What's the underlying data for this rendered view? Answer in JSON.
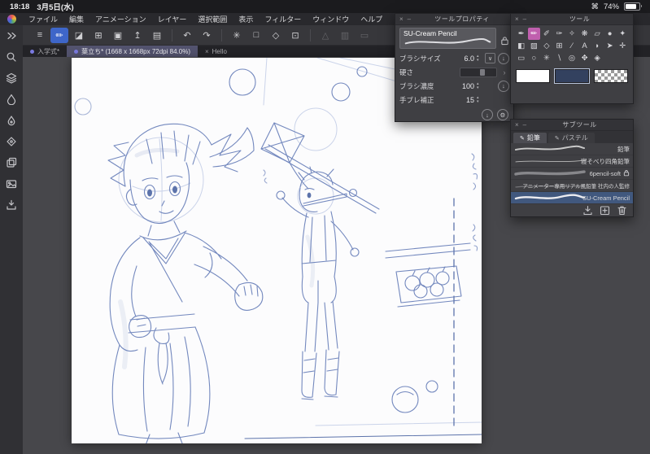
{
  "status_bar": {
    "time": "18:18",
    "date": "3月5日(水)",
    "command_icon": "⌘",
    "battery_percent": "74%"
  },
  "menu_bar": {
    "items": [
      "ファイル",
      "編集",
      "アニメーション",
      "レイヤー",
      "選択範囲",
      "表示",
      "フィルター",
      "ウィンドウ",
      "ヘルプ"
    ]
  },
  "toolbar": {
    "buttons": [
      {
        "name": "main-menu",
        "glyph": "≡"
      },
      {
        "name": "brush-tool",
        "glyph": "✏"
      },
      {
        "name": "color-set",
        "glyph": "◪"
      },
      {
        "name": "new-canvas",
        "glyph": "⊞"
      },
      {
        "name": "open-file",
        "glyph": "▣"
      },
      {
        "name": "export",
        "glyph": "↥"
      },
      {
        "name": "print",
        "glyph": "▤"
      },
      {
        "name": "undo",
        "glyph": "↶"
      },
      {
        "name": "redo",
        "glyph": "↷"
      },
      {
        "name": "auto-select",
        "glyph": "✳"
      },
      {
        "name": "select-area",
        "glyph": "□"
      },
      {
        "name": "eraser",
        "glyph": "◇"
      },
      {
        "name": "crop",
        "glyph": "⊡"
      },
      {
        "name": "snap-linear",
        "glyph": "△"
      },
      {
        "name": "snap-curve",
        "glyph": "▥"
      },
      {
        "name": "snap-ruler",
        "glyph": "▭"
      }
    ]
  },
  "tab_bar": {
    "tabs": [
      {
        "label": "入学式*"
      },
      {
        "label": "葉立ち* (1668 x 1668px 72dpi 84.0%)"
      },
      {
        "label": "Hello",
        "close": "×"
      }
    ]
  },
  "sidebar": {
    "items": [
      "collapse",
      "search",
      "layer-stack",
      "ink-droplet",
      "paint-droplet",
      "material",
      "layers-alt",
      "image",
      "import"
    ]
  },
  "tool_property_panel": {
    "close": "×",
    "minimize": "–",
    "title": "ツールプロパティ",
    "brush_name": "SU-Cream Pencil",
    "params": [
      {
        "label": "ブラシサイズ",
        "value": "6.0"
      },
      {
        "label": "硬さ",
        "value": ""
      },
      {
        "label": "ブラシ濃度",
        "value": "100"
      },
      {
        "label": "手ブレ補正",
        "value": "15"
      }
    ],
    "stepper_up": "▴",
    "stepper_down": "▾",
    "dropdown": "∨",
    "chevron": "›",
    "slider_button": "↓",
    "save_default": "↓",
    "settings": "⚙"
  },
  "tool_panel": {
    "close": "×",
    "minimize": "–",
    "title": "ツール",
    "tools": [
      {
        "name": "pen",
        "glyph": "✒"
      },
      {
        "name": "pencil",
        "glyph": "✏",
        "selected": true
      },
      {
        "name": "marker",
        "glyph": "✐"
      },
      {
        "name": "brush",
        "glyph": "✑"
      },
      {
        "name": "airbrush",
        "glyph": "✧"
      },
      {
        "name": "decoration",
        "glyph": "❋"
      },
      {
        "name": "eraser",
        "glyph": "▱"
      },
      {
        "name": "blend",
        "glyph": "●"
      },
      {
        "name": "liquify",
        "glyph": "✦"
      },
      {
        "name": "fill",
        "glyph": "◧"
      },
      {
        "name": "gradient",
        "glyph": "▨"
      },
      {
        "name": "figure",
        "glyph": "◇"
      },
      {
        "name": "frame",
        "glyph": "⊞"
      },
      {
        "name": "ruler",
        "glyph": "∕"
      },
      {
        "name": "text",
        "glyph": "A"
      },
      {
        "name": "balloon",
        "glyph": "◗"
      },
      {
        "name": "operation",
        "glyph": "➤"
      },
      {
        "name": "layer-move",
        "glyph": "✛"
      },
      {
        "name": "select-rect",
        "glyph": "▭"
      },
      {
        "name": "select-lasso",
        "glyph": "○"
      },
      {
        "name": "auto-select",
        "glyph": "✳"
      },
      {
        "name": "eyedropper",
        "glyph": "∖"
      },
      {
        "name": "zoom",
        "glyph": "◎"
      },
      {
        "name": "hand",
        "glyph": "✥"
      },
      {
        "name": "navigate",
        "glyph": "◈"
      }
    ],
    "swatches": [
      {
        "name": "main-color",
        "value": "#ffffff"
      },
      {
        "name": "sub-color",
        "value": "#33415f",
        "selected": true
      },
      {
        "name": "transparent",
        "value": "transparent"
      }
    ]
  },
  "subtool_panel": {
    "close": "×",
    "minimize": "–",
    "title": "サブツール",
    "tabs": [
      {
        "label": "鉛筆",
        "icon": "✎"
      },
      {
        "label": "パステル",
        "icon": "✎"
      }
    ],
    "items": [
      {
        "name": "鉛筆"
      },
      {
        "name": "寝そべり四角鉛筆"
      },
      {
        "name": "6pencil-soft",
        "locked": true
      },
      {
        "name": "アニメーター専用リアル風鉛筆 社内の人監修"
      },
      {
        "name": "SU-Cream Pencil",
        "selected": true
      }
    ]
  },
  "colors": {
    "accent_blue": "#3e66c9",
    "selected_pink": "#c05fae",
    "selected_row_blue": "#41587e",
    "sketch_blue": "#7388be"
  }
}
